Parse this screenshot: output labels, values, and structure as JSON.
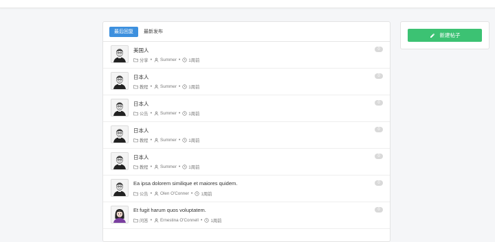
{
  "tabs": [
    {
      "label": "最后回复",
      "active": true
    },
    {
      "label": "最新发布",
      "active": false
    }
  ],
  "topics": [
    {
      "title": "美国人",
      "category": "分享",
      "author": "Summer",
      "time": "1周前",
      "reply_count": "0",
      "avatar": "male"
    },
    {
      "title": "日本人",
      "category": "教程",
      "author": "Summer",
      "time": "1周前",
      "reply_count": "0",
      "avatar": "male"
    },
    {
      "title": "日本人",
      "category": "公告",
      "author": "Summer",
      "time": "1周前",
      "reply_count": "0",
      "avatar": "male"
    },
    {
      "title": "日本人",
      "category": "教程",
      "author": "Summer",
      "time": "1周前",
      "reply_count": "0",
      "avatar": "male"
    },
    {
      "title": "日本人",
      "category": "教程",
      "author": "Summer",
      "time": "1周前",
      "reply_count": "0",
      "avatar": "male"
    },
    {
      "title": "Ea ipsa dolorem similique et maiores quidem.",
      "category": "公告",
      "author": "Olen O'Conner",
      "time": "1周前",
      "reply_count": "0",
      "avatar": "male"
    },
    {
      "title": "Et fugit harum quos voluptatem.",
      "category": "问答",
      "author": "Ernestina O'Connell",
      "time": "1周前",
      "reply_count": "0",
      "avatar": "female"
    }
  ],
  "sidebar": {
    "new_post_label": "新建帖子",
    "new_post_icon": "pencil-icon"
  },
  "colors": {
    "primary": "#3d90de",
    "success": "#3cc273",
    "badge": "#d9d9d9"
  }
}
